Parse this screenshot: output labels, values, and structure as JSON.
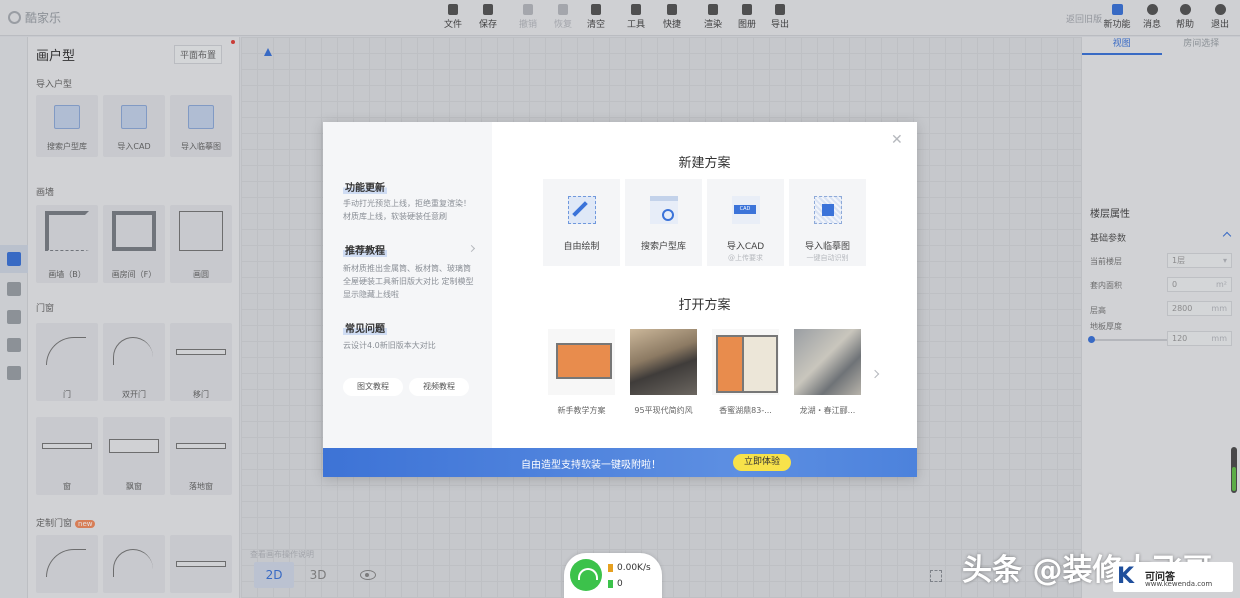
{
  "app": {
    "logo_text": "酷家乐",
    "back_label": "返回旧版"
  },
  "toolbar": {
    "items": [
      {
        "label": "文件",
        "icon": "file-icon"
      },
      {
        "label": "保存",
        "icon": "save-icon"
      },
      {
        "label": "撤销",
        "icon": "undo-icon"
      },
      {
        "label": "恢复",
        "icon": "redo-icon"
      },
      {
        "label": "清空",
        "icon": "eraser-icon"
      },
      {
        "label": "工具",
        "icon": "wrench-icon"
      },
      {
        "label": "快捷",
        "icon": "lightning-icon"
      },
      {
        "label": "渲染",
        "icon": "camera-icon"
      },
      {
        "label": "图册",
        "icon": "album-icon"
      },
      {
        "label": "导出",
        "icon": "export-icon"
      }
    ],
    "right": [
      {
        "label": "新功能",
        "icon": "new-feature-icon"
      },
      {
        "label": "消息",
        "icon": "bell-icon"
      },
      {
        "label": "帮助",
        "icon": "help-icon"
      },
      {
        "label": "退出",
        "icon": "logout-icon"
      }
    ]
  },
  "left_panel": {
    "title": "画户型",
    "layout_button": "平面布置",
    "sections": {
      "import": "导入户型",
      "walls": "画墙",
      "doors": "门窗",
      "custom": "定制门窗",
      "custom_badge": "new"
    },
    "import_items": [
      "搜索户型库",
      "导入CAD",
      "导入临摹图"
    ],
    "wall_items": [
      "画墙（B）",
      "画房间（F）",
      "画圆"
    ],
    "door_items": [
      "门",
      "双开门",
      "移门"
    ],
    "window_items": [
      "窗",
      "飘窗",
      "落地窗"
    ]
  },
  "canvas": {
    "view_tabs": [
      "2D",
      "3D"
    ],
    "active_view": "2D",
    "help_tip": "查看画布操作说明"
  },
  "right_panel": {
    "tabs": [
      "视图",
      "房间选择"
    ],
    "section_title": "楼层属性",
    "sub_title": "基础参数",
    "rows": [
      {
        "label": "当前楼层",
        "value": "1层",
        "unit": ""
      },
      {
        "label": "套内面积",
        "value": "0",
        "unit": "m²"
      },
      {
        "label": "层高",
        "value": "2800",
        "unit": "mm"
      },
      {
        "label": "地板厚度",
        "value": "120",
        "unit": "mm"
      }
    ]
  },
  "modal": {
    "sidebar": {
      "update_title": "功能更新",
      "update_text": "手动打光预览上线，拒绝重复渲染！材质库上线，软装硬装任意刷",
      "tutorial_title": "推荐教程",
      "tutorial_text": "新材质推出金属筒、板材筒、玻璃筒 全屋硬装工具新旧版大对比 定制模型显示隐藏上线啦",
      "faq_title": "常见问题",
      "faq_text": "云设计4.0新旧版本大对比",
      "btn_graphic": "图文教程",
      "btn_video": "视频教程"
    },
    "new_title": "新建方案",
    "new_items": [
      {
        "title": "自由绘制",
        "sub": ""
      },
      {
        "title": "搜索户型库",
        "sub": ""
      },
      {
        "title": "导入CAD",
        "sub": "@上传要求"
      },
      {
        "title": "导入临摹图",
        "sub": "一键自动识别"
      }
    ],
    "open_title": "打开方案",
    "open_items": [
      "新手教学方案",
      "95平现代简约风",
      "香蜜湖鼎83-...",
      "龙湖・春江郦..."
    ],
    "banner_text": "自由造型支持软装一键吸附啦！",
    "banner_cta": "立即体验"
  },
  "network": {
    "speed": "0.00K/s",
    "battery": "0"
  },
  "watermark": {
    "text": "头条 @装修大飞哥",
    "site_name": "可问答",
    "site_url": "www.kewenda.com"
  },
  "colors": {
    "accent": "#3b73d9",
    "banner": "#3d73d6",
    "cta": "#f7e24a",
    "wifi": "#3cc24b"
  }
}
